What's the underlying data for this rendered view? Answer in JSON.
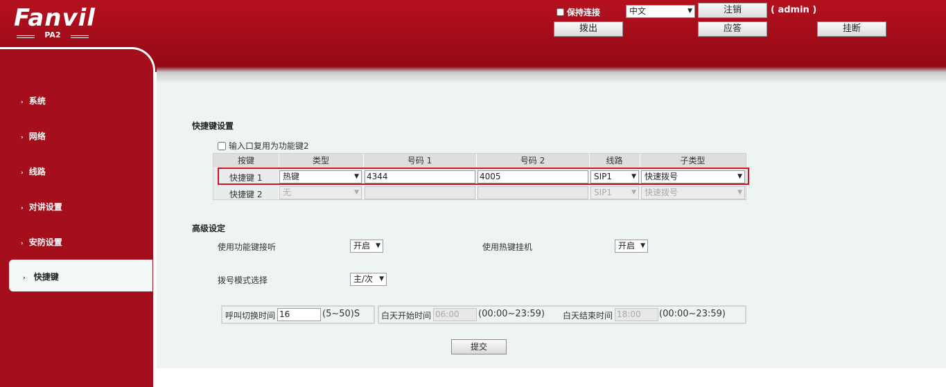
{
  "brand": {
    "logo": "Fanvil",
    "model": "PA2"
  },
  "header": {
    "keep_connection_label": "保持连接",
    "language_selected": "中文",
    "logout_label": "注销",
    "user": "( admin )",
    "dial_label": "拨出",
    "answer_label": "应答",
    "hangup_label": "挂断"
  },
  "sidebar": {
    "items": [
      {
        "label": "系统"
      },
      {
        "label": "网络"
      },
      {
        "label": "线路"
      },
      {
        "label": "对讲设置"
      },
      {
        "label": "安防设置"
      },
      {
        "label": "快捷键"
      }
    ],
    "active_index": 5
  },
  "function_keys": {
    "title": "快捷键设置",
    "input_reuse_label": "输入口复用为功能键2",
    "columns": [
      "按键",
      "类型",
      "号码 1",
      "号码 2",
      "线路",
      "子类型"
    ],
    "rows": [
      {
        "key": "快捷键 1",
        "type": "热键",
        "number1": "4344",
        "number2": "4005",
        "line": "SIP1",
        "subtype": "快速拨号"
      },
      {
        "key": "快捷键 2",
        "type": "无",
        "number1": "",
        "number2": "",
        "line": "SIP1",
        "subtype": "快速拨号"
      }
    ]
  },
  "advanced": {
    "title": "高级设定",
    "fk_answer_label": "使用功能键接听",
    "fk_answer_value": "开启",
    "hotkey_hangup_label": "使用热键挂机",
    "hotkey_hangup_value": "开启",
    "dial_mode_label": "拨号模式选择",
    "dial_mode_value": "主/次",
    "call_switch_label": "呼叫切换时间",
    "call_switch_value": "16",
    "call_switch_range": "(5~50)S",
    "day_start_label": "白天开始时间",
    "day_start_value": "06:00",
    "day_start_range": "(00:00~23:59)",
    "day_end_label": "白天结束时间",
    "day_end_value": "18:00",
    "day_end_range": "(00:00~23:59)",
    "submit_label": "提交"
  },
  "colors": {
    "header_red": "#a50f1b",
    "highlight_border": "#d2111e",
    "content_bg": "#eef3f4"
  }
}
